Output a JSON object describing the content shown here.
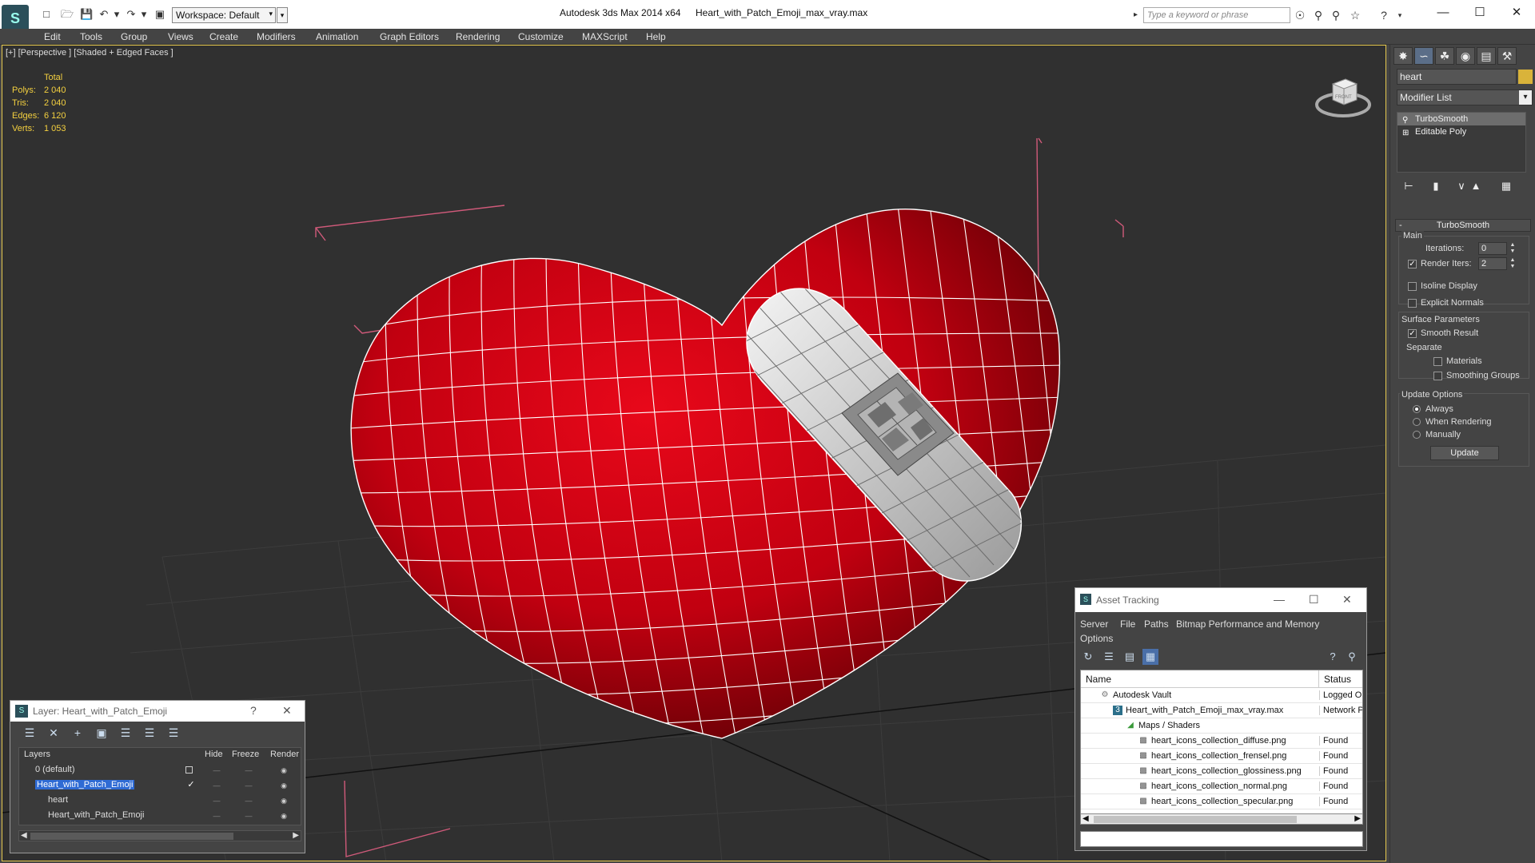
{
  "titlebar": {
    "workspace": "Workspace: Default",
    "app_title": "Autodesk 3ds Max  2014 x64",
    "doc_title": "Heart_with_Patch_Emoji_max_vray.max",
    "search_placeholder": "Type a keyword or phrase"
  },
  "menu": [
    "Edit",
    "Tools",
    "Group",
    "Views",
    "Create",
    "Modifiers",
    "Animation",
    "Graph Editors",
    "Rendering",
    "Customize",
    "MAXScript",
    "Help"
  ],
  "viewport": {
    "label": "[+] [Perspective ] [Shaded + Edged Faces ]",
    "stats": {
      "header": "Total",
      "rows": [
        {
          "k": "Polys:",
          "v": "2 040"
        },
        {
          "k": "Tris:",
          "v": "2 040"
        },
        {
          "k": "Edges:",
          "v": "6 120"
        },
        {
          "k": "Verts:",
          "v": "1 053"
        }
      ]
    },
    "viewcube_label": "FRONT"
  },
  "command_panel": {
    "object_name": "heart",
    "modifier_list": "Modifier List",
    "stack": [
      "TurboSmooth",
      "Editable Poly"
    ],
    "rollout": "TurboSmooth",
    "main_group": "Main",
    "iterations_label": "Iterations:",
    "iterations": "0",
    "render_iters_label": "Render Iters:",
    "render_iters": "2",
    "isoline": "Isoline Display",
    "explicit_normals": "Explicit Normals",
    "surface_group": "Surface Parameters",
    "smooth_result": "Smooth Result",
    "separate": "Separate",
    "materials": "Materials",
    "smoothing_groups": "Smoothing Groups",
    "update_group": "Update Options",
    "always": "Always",
    "when_rendering": "When Rendering",
    "manually": "Manually",
    "update_btn": "Update"
  },
  "layer_dialog": {
    "title": "Layer: Heart_with_Patch_Emoji",
    "help": "?",
    "columns": [
      "Layers",
      "Hide",
      "Freeze",
      "Render"
    ],
    "rows": [
      "0 (default)",
      "Heart_with_Patch_Emoji",
      "heart",
      "Heart_with_Patch_Emoji"
    ]
  },
  "asset_dialog": {
    "title": "Asset Tracking",
    "menu": [
      "Server",
      "File",
      "Paths",
      "Bitmap Performance and Memory",
      "Options"
    ],
    "columns": [
      "Name",
      "Status"
    ],
    "rows": [
      {
        "name": "Autodesk Vault",
        "status": "Logged Out"
      },
      {
        "name": "Heart_with_Patch_Emoji_max_vray.max",
        "status": "Network Path"
      },
      {
        "name": "Maps / Shaders",
        "status": ""
      },
      {
        "name": "heart_icons_collection_diffuse.png",
        "status": "Found"
      },
      {
        "name": "heart_icons_collection_frensel.png",
        "status": "Found"
      },
      {
        "name": "heart_icons_collection_glossiness.png",
        "status": "Found"
      },
      {
        "name": "heart_icons_collection_normal.png",
        "status": "Found"
      },
      {
        "name": "heart_icons_collection_specular.png",
        "status": "Found"
      }
    ]
  },
  "colors": {
    "heart_red": "#c00008",
    "patch_white": "#d8d8d8",
    "bbox_pink": "#d05a7a",
    "selection_blue": "#2f6bd4",
    "stats_yellow": "#f4d03f"
  }
}
